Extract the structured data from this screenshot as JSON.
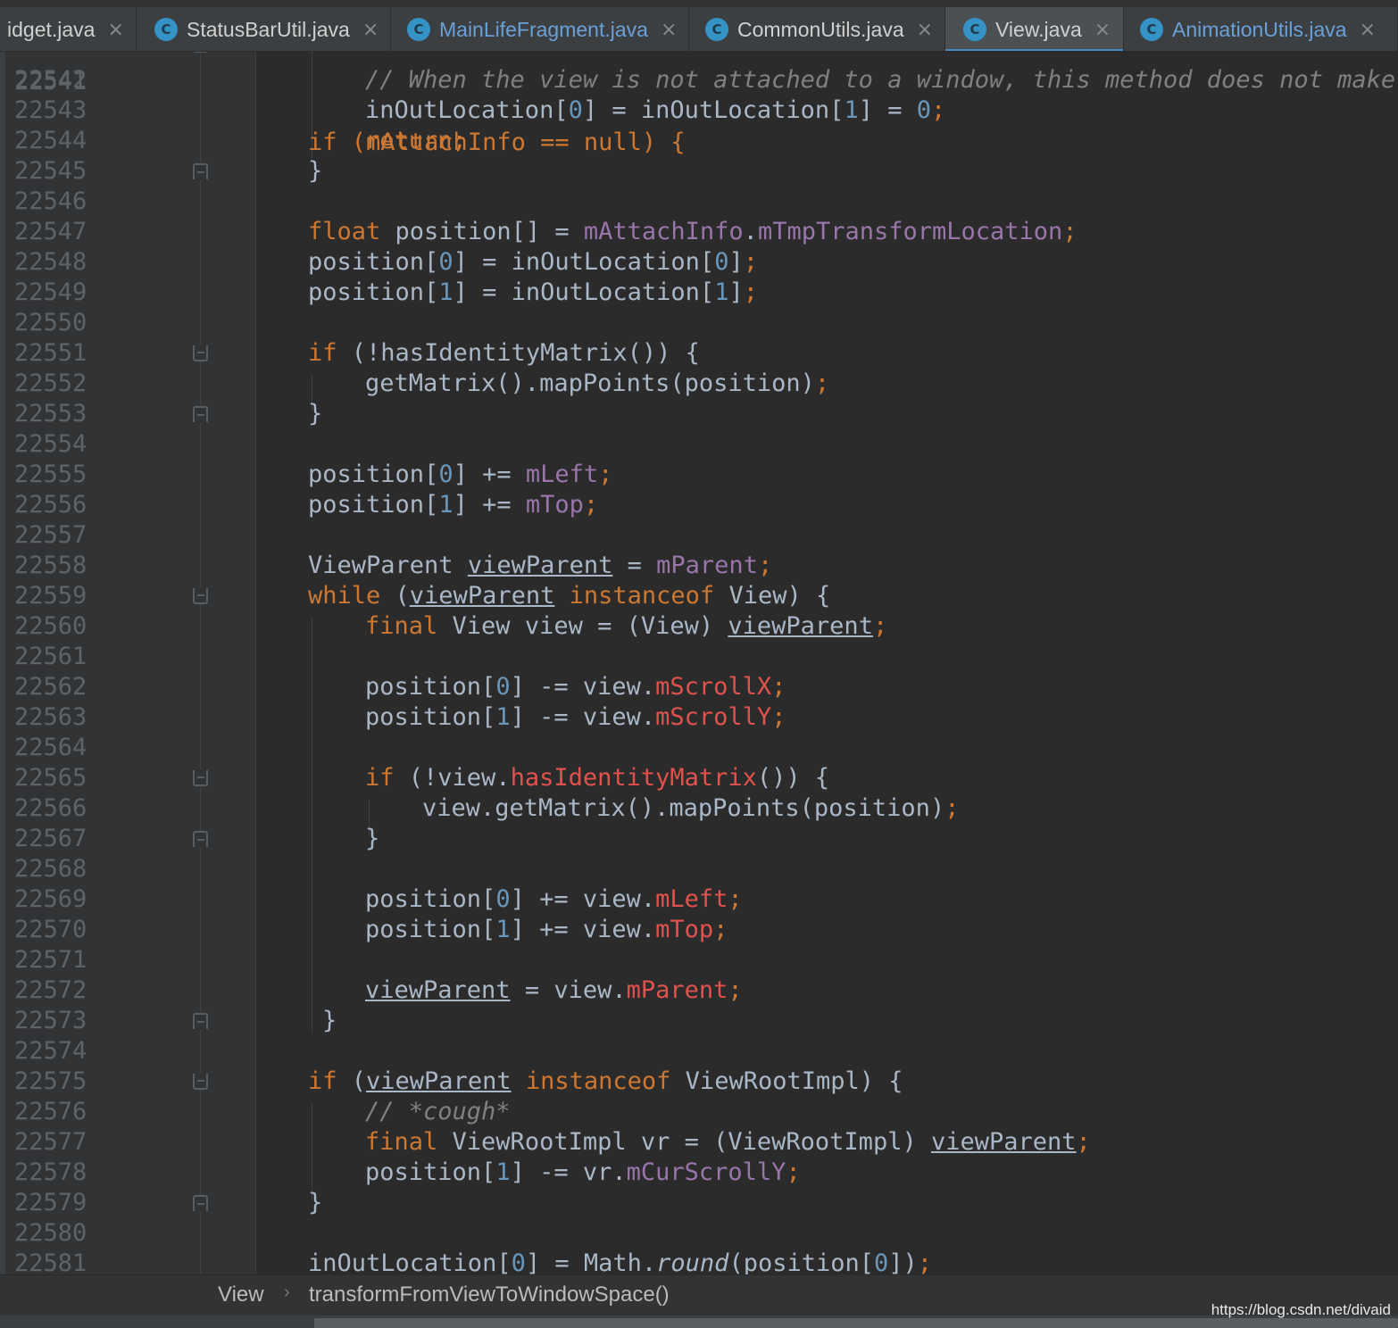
{
  "tabs": [
    {
      "label": "idget.java",
      "icon": "class-c-icon",
      "active": false
    },
    {
      "label": "StatusBarUtil.java",
      "icon": "class-c-icon",
      "active": false
    },
    {
      "label": "MainLifeFragment.java",
      "icon": "class-c-icon",
      "active": false
    },
    {
      "label": "CommonUtils.java",
      "icon": "class-c-icon",
      "active": false
    },
    {
      "label": "View.java",
      "icon": "class-c-icon",
      "active": true
    },
    {
      "label": "AnimationUtils.java",
      "icon": "class-c-icon",
      "active": false
    }
  ],
  "tab_icon_letter": "C",
  "tab_close_glyph": "×",
  "editor": {
    "first_line_partial": {
      "number": "22541",
      "code": "if (mAttachInfo == null) {"
    },
    "lines": [
      {
        "number": "22542",
        "code": "// When the view is not attached to a window, this method does not make sense"
      },
      {
        "number": "22543",
        "code": "inOutLocation[0] = inOutLocation[1] = 0;"
      },
      {
        "number": "22544",
        "code": "return;"
      },
      {
        "number": "22545",
        "code": "}"
      },
      {
        "number": "22546",
        "code": ""
      },
      {
        "number": "22547",
        "code": "float position[] = mAttachInfo.mTmpTransformLocation;"
      },
      {
        "number": "22548",
        "code": "position[0] = inOutLocation[0];"
      },
      {
        "number": "22549",
        "code": "position[1] = inOutLocation[1];"
      },
      {
        "number": "22550",
        "code": ""
      },
      {
        "number": "22551",
        "code": "if (!hasIdentityMatrix()) {"
      },
      {
        "number": "22552",
        "code": "getMatrix().mapPoints(position);"
      },
      {
        "number": "22553",
        "code": "}"
      },
      {
        "number": "22554",
        "code": ""
      },
      {
        "number": "22555",
        "code": "position[0] += mLeft;"
      },
      {
        "number": "22556",
        "code": "position[1] += mTop;"
      },
      {
        "number": "22557",
        "code": ""
      },
      {
        "number": "22558",
        "code": "ViewParent viewParent = mParent;"
      },
      {
        "number": "22559",
        "code": "while (viewParent instanceof View) {"
      },
      {
        "number": "22560",
        "code": "final View view = (View) viewParent;"
      },
      {
        "number": "22561",
        "code": ""
      },
      {
        "number": "22562",
        "code": "position[0] -= view.mScrollX;"
      },
      {
        "number": "22563",
        "code": "position[1] -= view.mScrollY;"
      },
      {
        "number": "22564",
        "code": ""
      },
      {
        "number": "22565",
        "code": "if (!view.hasIdentityMatrix()) {"
      },
      {
        "number": "22566",
        "code": "view.getMatrix().mapPoints(position);"
      },
      {
        "number": "22567",
        "code": "}"
      },
      {
        "number": "22568",
        "code": ""
      },
      {
        "number": "22569",
        "code": "position[0] += view.mLeft;"
      },
      {
        "number": "22570",
        "code": "position[1] += view.mTop;"
      },
      {
        "number": "22571",
        "code": ""
      },
      {
        "number": "22572",
        "code": "viewParent = view.mParent;"
      },
      {
        "number": "22573",
        "code": "}"
      },
      {
        "number": "22574",
        "code": ""
      },
      {
        "number": "22575",
        "code": "if (viewParent instanceof ViewRootImpl) {"
      },
      {
        "number": "22576",
        "code": "// *cough*"
      },
      {
        "number": "22577",
        "code": "final ViewRootImpl vr = (ViewRootImpl) viewParent;"
      },
      {
        "number": "22578",
        "code": "position[1] -= vr.mCurScrollY;"
      },
      {
        "number": "22579",
        "code": "}"
      },
      {
        "number": "22580",
        "code": ""
      },
      {
        "number": "22581",
        "code": "inOutLocation[0] = Math.round(position[0]);"
      }
    ]
  },
  "breadcrumb": {
    "class_name": "View",
    "separator": "›",
    "method_name": "transformFromViewToWindowSpace()"
  },
  "watermark": "https://blog.csdn.net/divaid",
  "colors": {
    "background": "#2b2b2b",
    "gutter": "#313335",
    "keyword": "#cc7832",
    "comment": "#808080",
    "number": "#6897bb",
    "field": "#9876aa",
    "error_field": "#e0524d",
    "default_text": "#a9b7c6",
    "line_number": "#606366",
    "active_tab_underline": "#4a88c7"
  }
}
